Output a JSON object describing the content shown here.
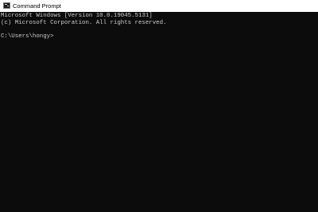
{
  "window": {
    "title": "Command Prompt",
    "icon": "cmd-icon"
  },
  "console": {
    "lines": [
      "Microsoft Windows [Version 10.0.19045.5131]",
      "(c) Microsoft Corporation. All rights reserved.",
      "C:\\Users\\hongy>"
    ],
    "background": "#0c0c0c",
    "text_color": "#cccccc"
  }
}
